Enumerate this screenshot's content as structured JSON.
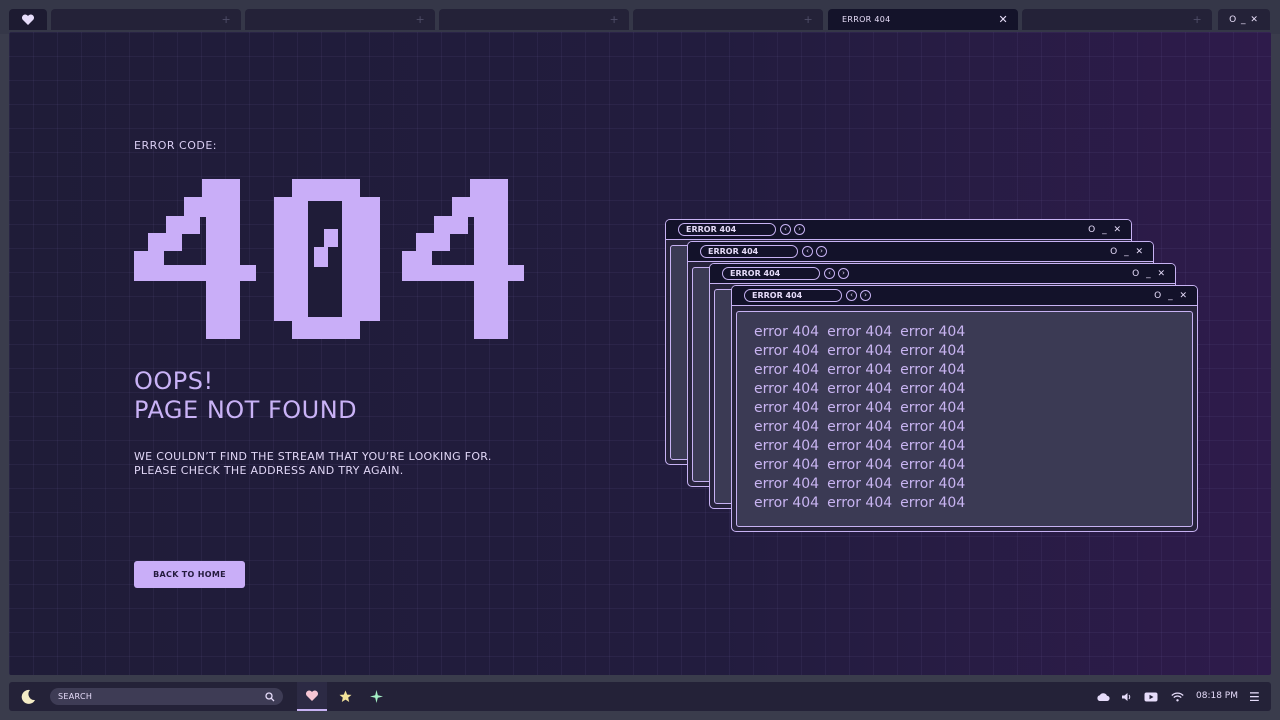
{
  "tabs": {
    "items": [
      {
        "label": "",
        "plus": "+"
      },
      {
        "label": "",
        "plus": "+"
      },
      {
        "label": "",
        "plus": "+"
      },
      {
        "label": "",
        "plus": "+"
      },
      {
        "label": "ERROR 404",
        "close": "✕"
      },
      {
        "label": "",
        "plus": "+"
      }
    ],
    "window_controls": "O _ ✕"
  },
  "main": {
    "error_code_label": "ERROR CODE:",
    "error_number": "404",
    "heading_line1": "OOPS!",
    "heading_line2": "PAGE NOT FOUND",
    "description_line1": "WE COULDN’T FIND THE STREAM THAT YOU’RE LOOKING FOR.",
    "description_line2": "PLEASE CHECK THE ADDRESS AND TRY AGAIN.",
    "back_button": "BACK TO HOME"
  },
  "windows": {
    "title": "ERROR 404",
    "nav_back": "‹",
    "nav_forward": "›",
    "controls": "O _ ✕",
    "error_text": "error 404",
    "rows": 10,
    "columns": 3
  },
  "taskbar": {
    "search_label": "SEARCH",
    "clock": "08:18 PM",
    "menu": "☰"
  },
  "colors": {
    "accent": "#c9aef8",
    "background": "#1f1c38",
    "panel_border": "#c7b2f3",
    "heart": "#f6c6d4",
    "star": "#f3e39a",
    "sparkle": "#a6f0c6"
  }
}
